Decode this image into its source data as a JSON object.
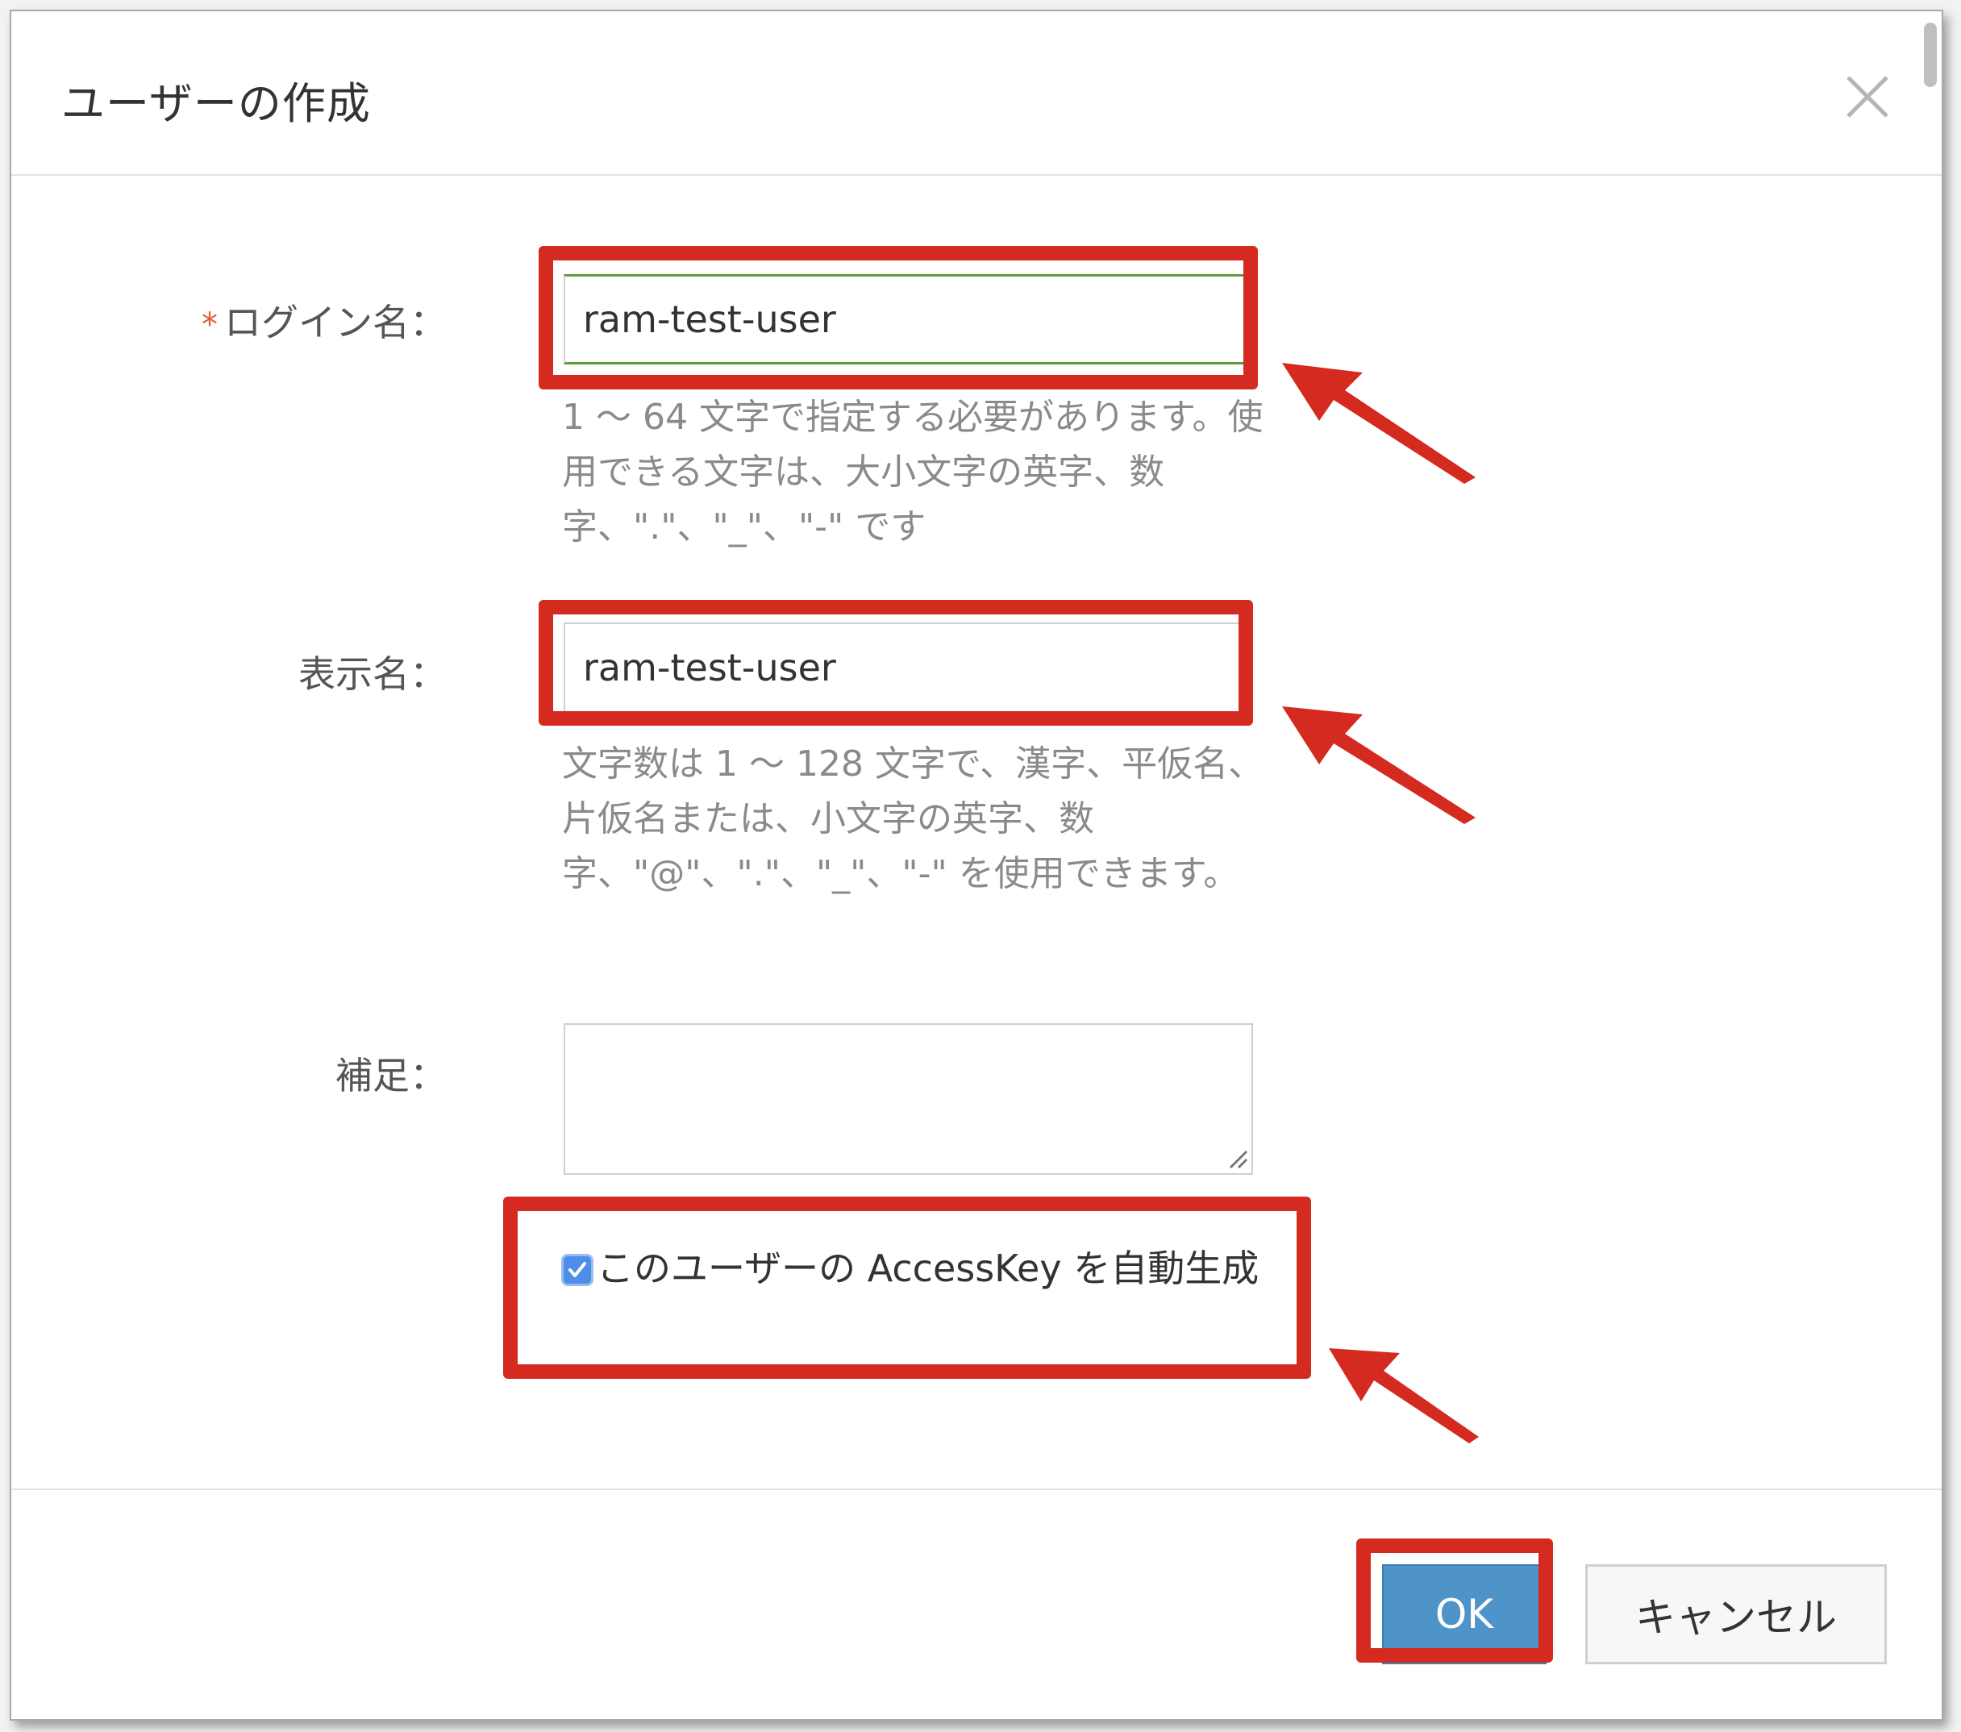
{
  "dialog": {
    "title": "ユーザーの作成",
    "close_icon": "close-icon"
  },
  "form": {
    "login_name": {
      "required_mark": "*",
      "label": "ログイン名：",
      "value": "ram-test-user",
      "hint": "1 ～ 64 文字で指定する必要があります。使用できる文字は、大小文字の英字、数字、\".\"、\"_\"、\"-\" です"
    },
    "display_name": {
      "label": "表示名：",
      "value": "ram-test-user",
      "hint": "文字数は 1 ～ 128 文字で、漢字、平仮名、片仮名または、小文字の英字、数字、\"@\"、\".\"、\"_\"、\"-\" を使用できます。"
    },
    "comment": {
      "label": "補足：",
      "value": ""
    },
    "access_key": {
      "checked": true,
      "label": "このユーザーの AccessKey を自動生成"
    }
  },
  "footer": {
    "ok_label": "OK",
    "cancel_label": "キャンセル"
  },
  "colors": {
    "highlight": "#d42a1f",
    "primary_button": "#4f94c9",
    "checkbox": "#4d8ee8",
    "focus_border": "#5c9e3c"
  }
}
